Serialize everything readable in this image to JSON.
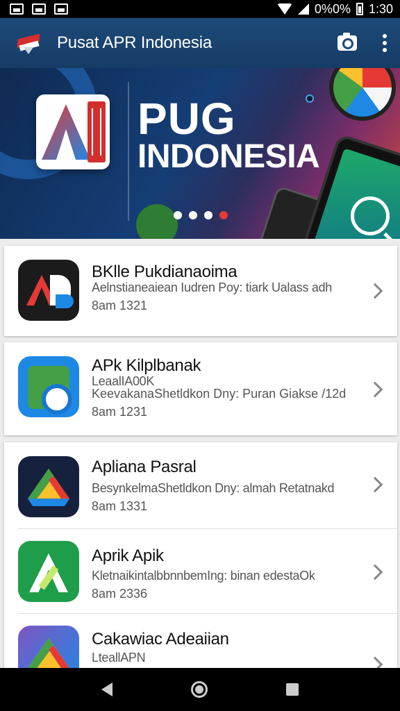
{
  "status_bar": {
    "battery_text": "0%0%",
    "time": "1:30",
    "icons": [
      "notification-icon",
      "notification-icon",
      "notification-icon",
      "wifi-icon",
      "signal-icon",
      "battery-icon"
    ]
  },
  "app_bar": {
    "title": "Pusat APR Indonesia",
    "icons": [
      "app-logo-icon",
      "camera-icon",
      "more-vert-icon"
    ]
  },
  "banner": {
    "line1": "PUG",
    "line2": "INDONESIA",
    "active_slide": 4,
    "slide_count": 4
  },
  "apps": [
    {
      "title": "BKlle Pukdianaoima",
      "line2": "Aelnstianeaiean Iudren Poy: tiark Ualass adh",
      "line3": "8am 1321",
      "icon": "ab-app-icon"
    },
    {
      "title": "APk Kilplbanak",
      "line2": "LeaalIA00K",
      "line3": "KeevakanaShetldkon Dny: Puran Giakse /12d",
      "line4": "8am 1231",
      "icon": "shopping-bag-app-icon"
    },
    {
      "title": "Apliana Pasral",
      "line2": "BesynkelmaShetldkon Dny: almah Retatnakd",
      "line3": "8am 1331",
      "icon": "drive-app-icon"
    },
    {
      "title": "Aprik Apik",
      "line2": "KletnaikintalbbnnbemIng: binan edestaOk",
      "line3": "8am 2336",
      "icon": "a-app-icon"
    },
    {
      "title": "Cakawiac Adeaiian",
      "line2": "LteallAPN",
      "icon": "drive-app-icon"
    }
  ],
  "nav_bar": {
    "icons": [
      "back-icon",
      "home-icon",
      "recents-icon"
    ]
  }
}
